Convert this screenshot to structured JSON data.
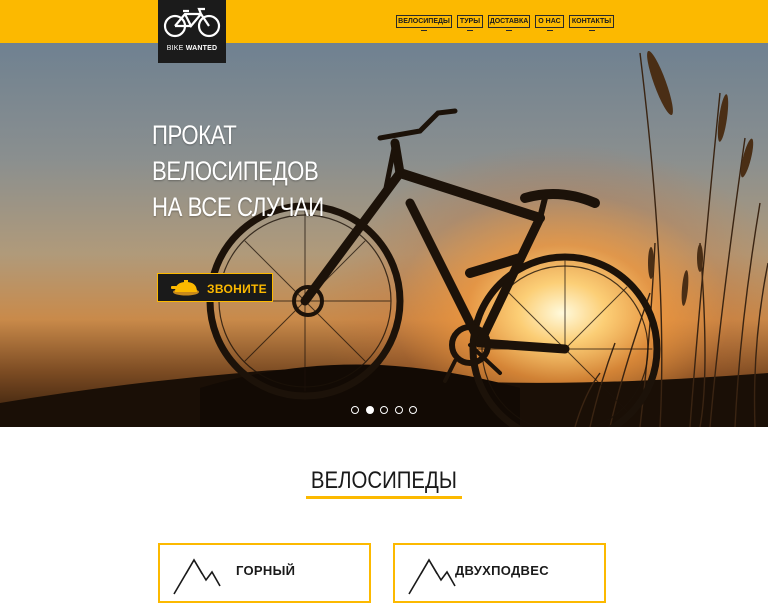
{
  "header": {
    "logo_text_light": "BIKE",
    "logo_text_bold": "WANTED",
    "logo_icon": "bicycle-icon",
    "nav": [
      "ВЕЛОСИПЕДЫ",
      "ТУРЫ",
      "ДОСТАВКА",
      "О НАС",
      "КОНТАКТЫ"
    ]
  },
  "hero": {
    "title_line1": "ПРОКАТ",
    "title_line2": "ВЕЛОСИПЕДОВ",
    "title_line3": "НА ВСЕ СЛУЧАИ",
    "call_button_label": "ЗВОНИТЕ",
    "call_icon": "bell-icon",
    "slides_total": 5,
    "active_slide": 2
  },
  "bikes_section": {
    "title": "ВЕЛОСИПЕДЫ",
    "cards": [
      {
        "label": "ГОРНЫЙ",
        "icon": "mountain-icon"
      },
      {
        "label": "ДВУХПОДВЕС",
        "icon": "mountain-icon"
      }
    ]
  },
  "colors": {
    "accent": "#fcb900",
    "dark": "#1b1b1b",
    "text": "#1a1a1a"
  }
}
